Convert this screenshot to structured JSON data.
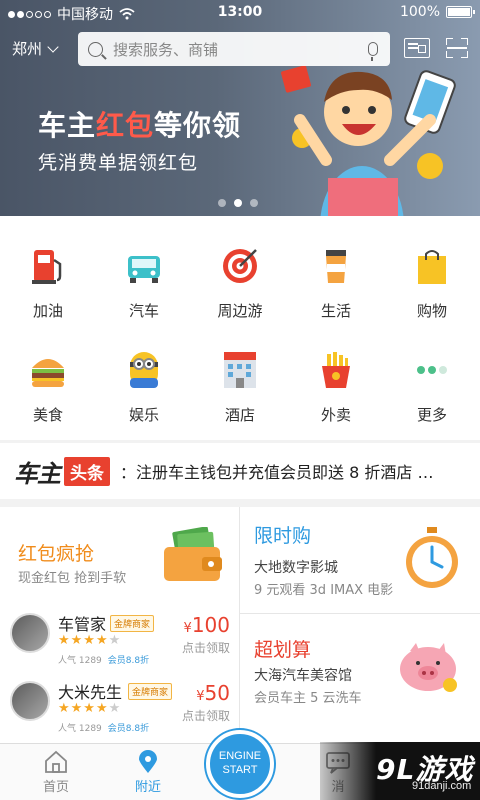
{
  "status_bar": {
    "carrier": "中国移动",
    "time": "13:00",
    "battery": "100%"
  },
  "topbar": {
    "city": "郑州",
    "search_placeholder": "搜索服务、商铺"
  },
  "banner": {
    "title_pre": "车主",
    "title_highlight": "红包",
    "title_post": "等你领",
    "subtitle": "凭消费单据领红包",
    "page_count": 3,
    "active_page": 2
  },
  "grid": {
    "items": [
      {
        "label": "加油",
        "icon": "gas-pump-icon"
      },
      {
        "label": "汽车",
        "icon": "car-icon"
      },
      {
        "label": "周边游",
        "icon": "target-icon"
      },
      {
        "label": "生活",
        "icon": "coffee-cup-icon"
      },
      {
        "label": "购物",
        "icon": "shopping-bag-icon"
      },
      {
        "label": "美食",
        "icon": "burger-icon"
      },
      {
        "label": "娱乐",
        "icon": "minion-icon"
      },
      {
        "label": "酒店",
        "icon": "hotel-icon"
      },
      {
        "label": "外卖",
        "icon": "fries-icon"
      },
      {
        "label": "更多",
        "icon": "more-dots-icon"
      }
    ]
  },
  "headline": {
    "brand_a": "车主",
    "brand_b": "头条",
    "text": "：注册车主钱包并充值会员即送 8 折酒店 …"
  },
  "promo": {
    "redpack": {
      "title": "红包疯抢",
      "subtitle": "现金红包 抢到手软"
    },
    "shops": [
      {
        "name": "车管家",
        "badge": "金牌商家",
        "rating": 4,
        "popularity": "人气 1289",
        "vip": "会员8.8折",
        "currency": "¥",
        "amount": "100",
        "claim": "点击领取"
      },
      {
        "name": "大米先生",
        "badge": "金牌商家",
        "rating": 4,
        "popularity": "人气 1289",
        "vip": "会员8.8折",
        "currency": "¥",
        "amount": "50",
        "claim": "点击领取"
      }
    ],
    "flash": {
      "title": "限时购",
      "line1": "大地数字影城",
      "line2": "9 元观看 3d IMAX 电影"
    },
    "deal": {
      "title": "超划算",
      "line1": "大海汽车美容馆",
      "line2": "会员车主 5 云洗车"
    }
  },
  "tabbar": {
    "tabs": [
      {
        "label": "首页",
        "active": false
      },
      {
        "label": "附近",
        "active": true
      },
      {
        "label": "消",
        "active": false
      }
    ],
    "engine_line1": "ENGINE",
    "engine_line2": "START"
  },
  "watermark": {
    "big": "9L游戏",
    "small": "91danji.com"
  },
  "colors": {
    "accent_blue": "#2e9ae0",
    "red": "#e8412f",
    "orange": "#f08c1c"
  }
}
